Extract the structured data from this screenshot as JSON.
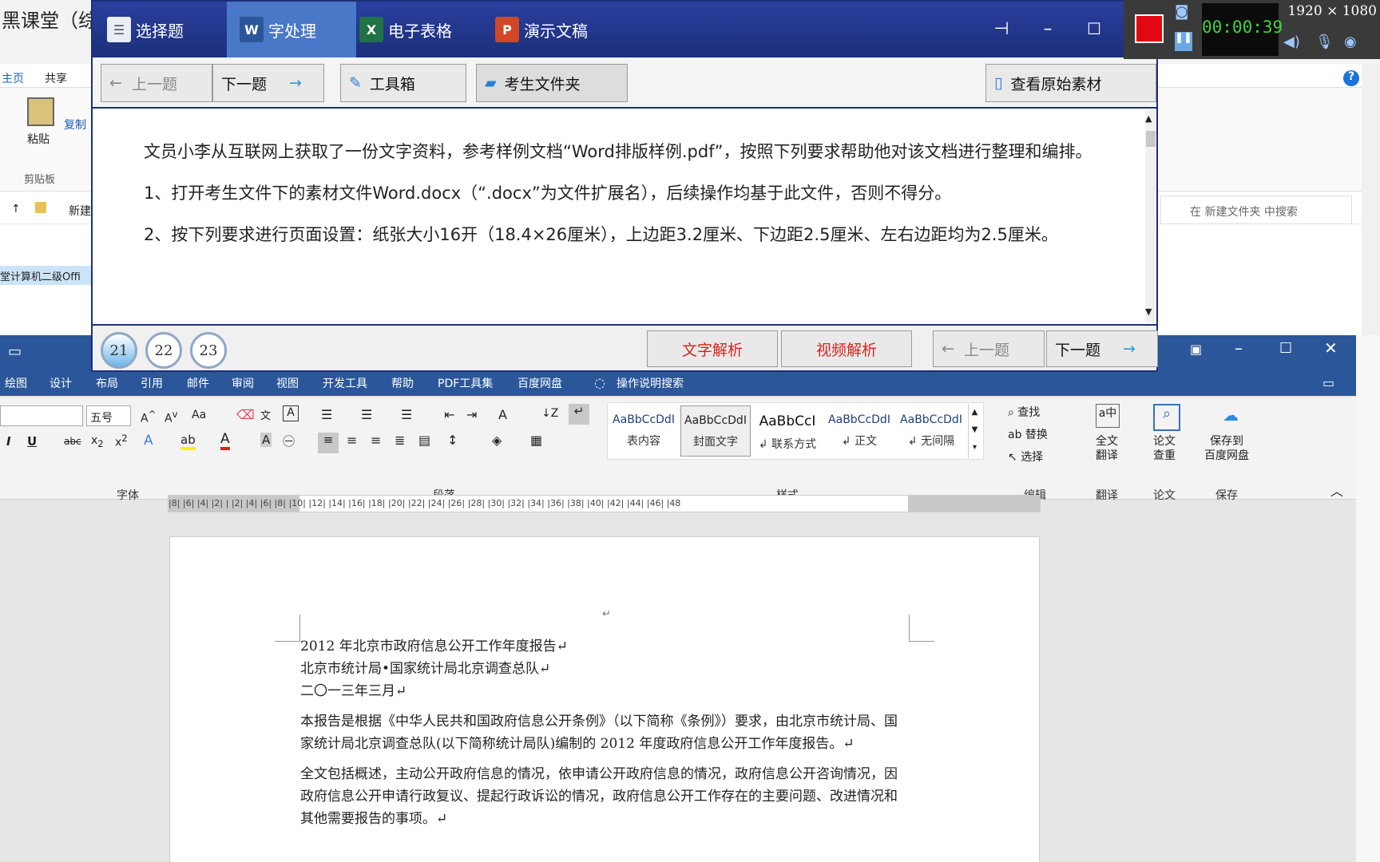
{
  "explorer": {
    "title": "黑课堂（综",
    "tabs": [
      "主页",
      "共享"
    ],
    "paste_label": "粘贴",
    "copy_label": "复制",
    "clipboard_label": "剪贴板",
    "address": "新建",
    "left_item": "堂计算机二级Offi",
    "search_placeholder": "在 新建文件夹 中搜索"
  },
  "exam": {
    "tabs": [
      "选择题",
      "字处理",
      "电子表格",
      "演示文稿"
    ],
    "prev_label": "上一题",
    "next_label": "下一题",
    "toolbox_label": "工具箱",
    "folder_label": "考生文件夹",
    "view_material_label": "查看原始素材",
    "question": [
      "文员小李从互联网上获取了一份文字资料，参考样例文档“Word排版样例.pdf”，按照下列要求帮助他对该文档进行整理和编排。",
      "1、打开考生文件下的素材文件Word.docx（“.docx”为文件扩展名），后续操作均基于此文件，否则不得分。",
      "2、按下列要求进行页面设置：纸张大小16开（18.4×26厘米），上边距3.2厘米、下边距2.5厘米、左右边距均为2.5厘米。"
    ],
    "pages": [
      "21",
      "22",
      "23"
    ],
    "text_analysis_label": "文字解析",
    "video_analysis_label": "视频解析",
    "bottom_prev_label": "上一题",
    "bottom_next_label": "下一题"
  },
  "recorder": {
    "time": "00:00:39",
    "resolution": "1920 × 1080"
  },
  "word": {
    "menu": [
      "绘图",
      "设计",
      "布局",
      "引用",
      "邮件",
      "审阅",
      "视图",
      "开发工具",
      "帮助",
      "PDF工具集",
      "百度网盘",
      "操作说明搜索"
    ],
    "font_size": "五号",
    "group_font": "字体",
    "group_paragraph": "段落",
    "group_styles": "样式",
    "group_edit": "编辑",
    "group_translate": "翻译",
    "group_paper": "论文",
    "group_save": "保存",
    "styles": [
      {
        "preview": "AaBbCcDdI",
        "name": "表内容"
      },
      {
        "preview": "AaBbCcDdI",
        "name": "封面文字"
      },
      {
        "preview": "AaBbCcI",
        "name": "↲ 联系方式"
      },
      {
        "preview": "AaBbCcDdI",
        "name": "↲ 正文"
      },
      {
        "preview": "AaBbCcDdI",
        "name": "↲ 无间隔"
      }
    ],
    "find_label": "查找",
    "replace_label": "替换",
    "select_label": "选择",
    "translate_label1": "全文",
    "translate_label2": "翻译",
    "paper_label1": "论文",
    "paper_label2": "查重",
    "save_label1": "保存到",
    "save_label2": "百度网盘",
    "ruler": "|8| |6| |4| |2| | |2| |4| |6| |8| |10| |12| |14| |16| |18| |20| |22| |24| |26| |28| |30| |32| |34| |36| |38| |40| |42| |44| |46| |48",
    "doc": {
      "line1": "2012 年北京市政府信息公开工作年度报告↵",
      "line2": "北京市统计局•国家统计局北京调查总队↵",
      "line3": "二〇一三年三月↵",
      "para1": "本报告是根据《中华人民共和国政府信息公开条例》（以下简称《条例》）要求，由北京市统计局、国家统计局北京调查总队(以下简称统计局队)编制的 2012 年度政府信息公开工作年度报告。↵",
      "para2": "全文包括概述，主动公开政府信息的情况，依申请公开政府信息的情况，政府信息公开咨询情况，因政府信息公开申请行政复议、提起行政诉讼的情况，政府信息公开工作存在的主要问题、改进情况和其他需要报告的事项。↵"
    }
  }
}
